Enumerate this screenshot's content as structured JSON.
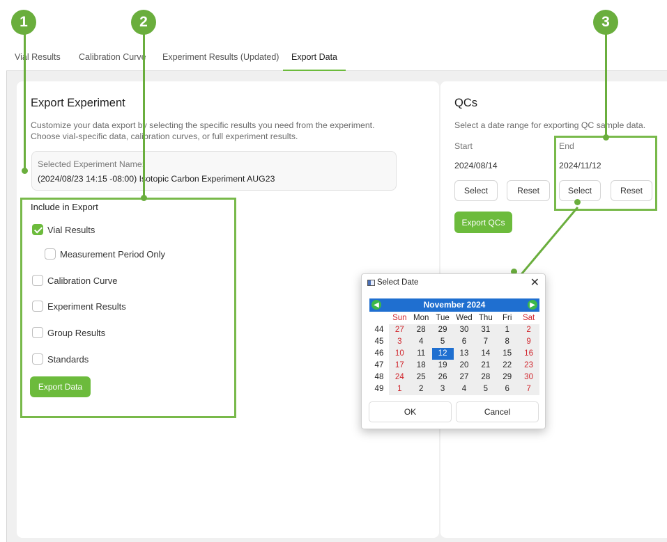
{
  "tabs": [
    "Vial Results",
    "Calibration Curve",
    "Experiment Results (Updated)",
    "Export Data"
  ],
  "export_experiment": {
    "title": "Export Experiment",
    "desc_line1": "Customize your data export by selecting the specific results you need from the experiment.",
    "desc_line2": "Choose vial-specific data, calibration curves, or full experiment results.",
    "selected_label": "Selected Experiment Name:",
    "selected_value": "(2024/08/23 14:15 -08:00) Isotopic Carbon Experiment AUG23",
    "include_label": "Include in Export",
    "options": [
      {
        "label": "Vial Results",
        "checked": true
      },
      {
        "label": "Measurement Period Only",
        "checked": false
      },
      {
        "label": "Calibration Curve",
        "checked": false
      },
      {
        "label": "Experiment Results",
        "checked": false
      },
      {
        "label": "Group Results",
        "checked": false
      },
      {
        "label": "Standards",
        "checked": false
      }
    ],
    "export_button": "Export Data"
  },
  "qcs": {
    "title": "QCs",
    "desc": "Select a date range for exporting QC sample data.",
    "start_label": "Start",
    "start_value": "2024/08/14",
    "end_label": "End",
    "end_value": "2024/11/12",
    "select_button": "Select",
    "reset_button": "Reset",
    "export_button": "Export QCs"
  },
  "callouts": [
    "1",
    "2",
    "3"
  ],
  "date_dialog": {
    "title": "Select Date",
    "close_glyph": "✕",
    "prev_glyph": "◀",
    "next_glyph": "▶",
    "month_year": "November  2024",
    "weekdays": [
      "Sun",
      "Mon",
      "Tue",
      "Wed",
      "Thu",
      "Fri",
      "Sat"
    ],
    "weeks": [
      {
        "week": "44",
        "days": [
          "27",
          "28",
          "29",
          "30",
          "31",
          "1",
          "2"
        ]
      },
      {
        "week": "45",
        "days": [
          "3",
          "4",
          "5",
          "6",
          "7",
          "8",
          "9"
        ]
      },
      {
        "week": "46",
        "days": [
          "10",
          "11",
          "12",
          "13",
          "14",
          "15",
          "16"
        ]
      },
      {
        "week": "47",
        "days": [
          "17",
          "18",
          "19",
          "20",
          "21",
          "22",
          "23"
        ]
      },
      {
        "week": "48",
        "days": [
          "24",
          "25",
          "26",
          "27",
          "28",
          "29",
          "30"
        ]
      },
      {
        "week": "49",
        "days": [
          "1",
          "2",
          "3",
          "4",
          "5",
          "6",
          "7"
        ]
      }
    ],
    "selected_day": "12",
    "ok_button": "OK",
    "cancel_button": "Cancel"
  },
  "colors": {
    "accent": "#6cbb3c",
    "calendar_header": "#1f6fd0",
    "weekend": "#d0242b"
  }
}
